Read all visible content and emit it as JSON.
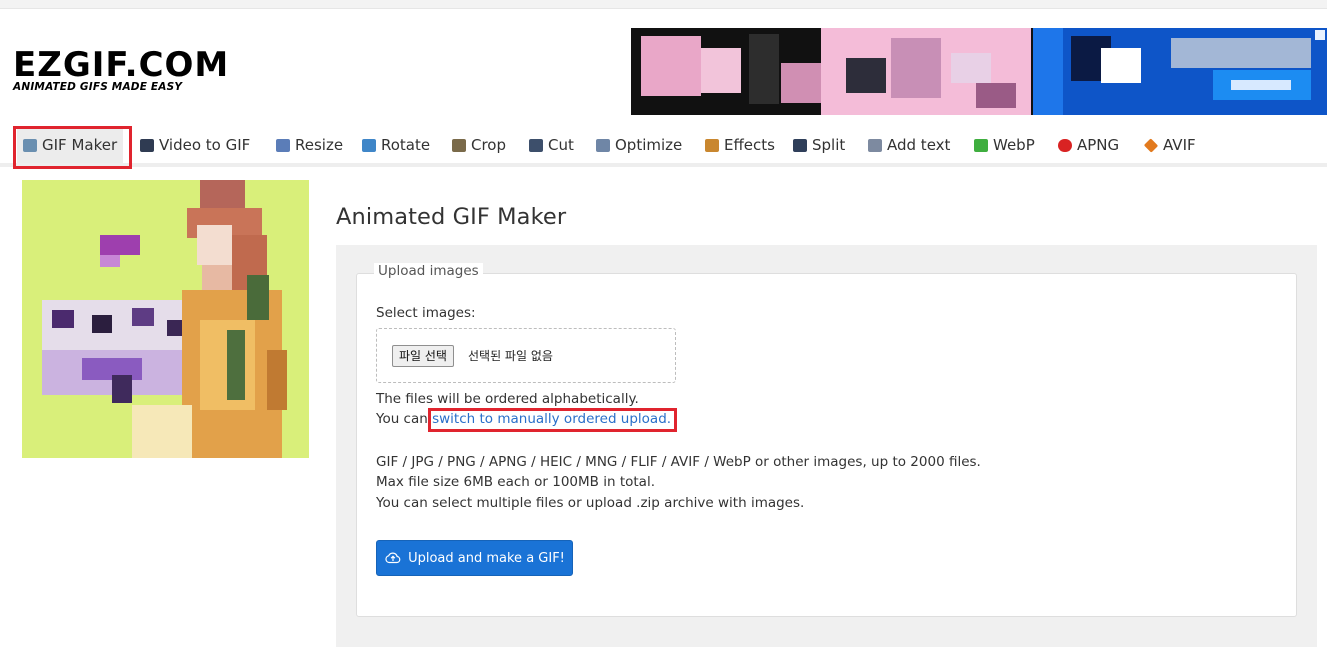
{
  "brand": {
    "logo_text": "EZGIF.COM",
    "tagline": "ANIMATED GIFS MADE EASY"
  },
  "nav": [
    {
      "label": "GIF Maker",
      "icon": "gif-maker-icon",
      "color": "#6a8fb0",
      "active": true
    },
    {
      "label": "Video to GIF",
      "icon": "film-icon",
      "color": "#2f3b52"
    },
    {
      "label": "Resize",
      "icon": "resize-icon",
      "color": "#5b7db8"
    },
    {
      "label": "Rotate",
      "icon": "rotate-icon",
      "color": "#3f86c8"
    },
    {
      "label": "Crop",
      "icon": "crop-icon",
      "color": "#7a6a4a"
    },
    {
      "label": "Cut",
      "icon": "cut-icon",
      "color": "#3d4f6b"
    },
    {
      "label": "Optimize",
      "icon": "optimize-icon",
      "color": "#6f86a6"
    },
    {
      "label": "Effects",
      "icon": "effects-icon",
      "color": "#c9872f"
    },
    {
      "label": "Split",
      "icon": "split-icon",
      "color": "#2f3f5a"
    },
    {
      "label": "Add text",
      "icon": "add-text-icon",
      "color": "#7d8aa0"
    },
    {
      "label": "WebP",
      "icon": "webp-icon",
      "color": "#3fae3f"
    },
    {
      "label": "APNG",
      "icon": "apng-icon",
      "color": "#d92323"
    },
    {
      "label": "AVIF",
      "icon": "avif-icon",
      "color": "#e27a1e"
    }
  ],
  "main": {
    "title": "Animated GIF Maker",
    "legend": "Upload images",
    "select_label": "Select images:",
    "file_button": "파일 선택",
    "file_status": "선택된 파일 없음",
    "order_note": "The files will be ordered alphabetically.",
    "switch_prefix": "You can ",
    "switch_link": "switch to manually ordered upload.",
    "formats": "GIF / JPG / PNG / APNG / HEIC / MNG / FLIF / AVIF / WebP or other images, up to 2000 files.",
    "max_size": "Max file size 6MB each or 100MB in total.",
    "multi_note": "You can select multiple files or upload .zip archive with images.",
    "upload_button": "Upload and make a GIF!"
  },
  "colors": {
    "accent": "#1a73d6",
    "link": "#2a6fc9",
    "highlight": "#e0242e"
  }
}
